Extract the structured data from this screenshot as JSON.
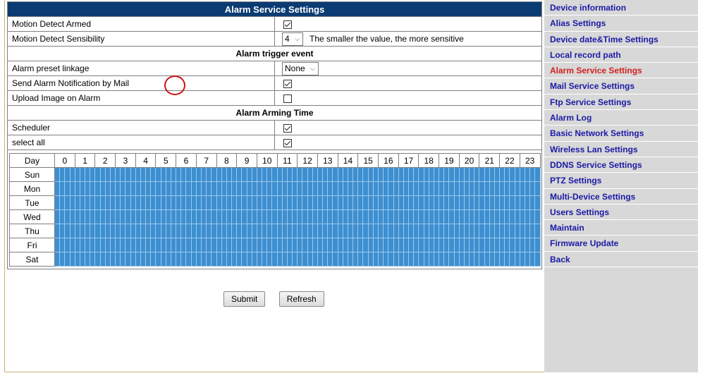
{
  "main": {
    "title": "Alarm Service Settings",
    "rows": {
      "motion_armed_label": "Motion Detect Armed",
      "motion_sens_label": "Motion Detect Sensibility",
      "motion_sens_value": "4",
      "motion_sens_hint": "The smaller the value, the more sensitive",
      "trigger_header": "Alarm trigger event",
      "preset_label": "Alarm preset linkage",
      "preset_value": "None",
      "mail_label": "Send Alarm Notification by Mail",
      "upload_label": "Upload Image on Alarm",
      "arming_header": "Alarm Arming Time",
      "scheduler_label": "Scheduler",
      "selectall_label": "select all"
    },
    "checks": {
      "motion_armed": true,
      "mail": true,
      "upload": false,
      "scheduler": true,
      "selectall": true
    },
    "schedule": {
      "day_header": "Day",
      "hours": [
        "0",
        "1",
        "2",
        "3",
        "4",
        "5",
        "6",
        "7",
        "8",
        "9",
        "10",
        "11",
        "12",
        "13",
        "14",
        "15",
        "16",
        "17",
        "18",
        "19",
        "20",
        "21",
        "22",
        "23"
      ],
      "days": [
        "Sun",
        "Mon",
        "Tue",
        "Wed",
        "Thu",
        "Fri",
        "Sat"
      ],
      "slots_per_hour": 4,
      "all_selected": true,
      "slot_color": "#3d8fd0"
    },
    "buttons": {
      "submit": "Submit",
      "refresh": "Refresh"
    }
  },
  "sidebar": {
    "items": [
      {
        "label": "Device information"
      },
      {
        "label": "Alias Settings"
      },
      {
        "label": "Device date&Time Settings"
      },
      {
        "label": "Local record path"
      },
      {
        "label": "Alarm Service Settings",
        "active": true
      },
      {
        "label": "Mail Service Settings"
      },
      {
        "label": "Ftp Service Settings"
      },
      {
        "label": "Alarm Log"
      },
      {
        "label": "Basic Network Settings"
      },
      {
        "label": "Wireless Lan Settings"
      },
      {
        "label": "DDNS Service Settings"
      },
      {
        "label": "PTZ Settings"
      },
      {
        "label": "Multi-Device Settings"
      },
      {
        "label": "Users Settings"
      },
      {
        "label": "Maintain"
      },
      {
        "label": "Firmware Update"
      },
      {
        "label": "Back"
      }
    ]
  },
  "colors": {
    "header_bg": "#0b3b73",
    "link": "#1a1aa6",
    "active_link": "#d42020",
    "highlight_circle": "#cc1111"
  }
}
